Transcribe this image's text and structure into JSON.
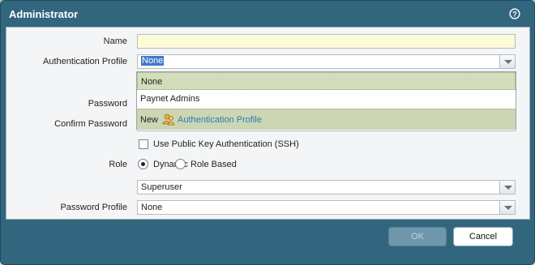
{
  "dialog": {
    "title": "Administrator",
    "help_icon": "help-icon"
  },
  "form": {
    "name_label": "Name",
    "name_value": "",
    "auth_profile_label": "Authentication Profile",
    "auth_profile_value": "None",
    "password_label": "Password",
    "confirm_password_label": "Confirm Password",
    "ssh_label": "Use Public Key Authentication (SSH)",
    "ssh_checked": false,
    "role_label": "Role",
    "role_options": [
      {
        "label": "Dynamic",
        "selected": true
      },
      {
        "label": "Role Based",
        "selected": false
      }
    ],
    "role_value": "Superuser",
    "password_profile_label": "Password Profile",
    "password_profile_value": "None"
  },
  "auth_dropdown": {
    "items": [
      "None",
      "Paynet Admins"
    ],
    "new_prefix": "New",
    "new_link": "Authentication Profile",
    "new_icon": "users-icon"
  },
  "buttons": {
    "ok": "OK",
    "cancel": "Cancel"
  },
  "colors": {
    "titlebar": "#32667f",
    "body": "#f4f5f6",
    "name_field": "#fcfcd7",
    "dropdown_highlight": "#d3ddbc",
    "link": "#2b7bb8",
    "ok_button": "#6f97ab"
  }
}
